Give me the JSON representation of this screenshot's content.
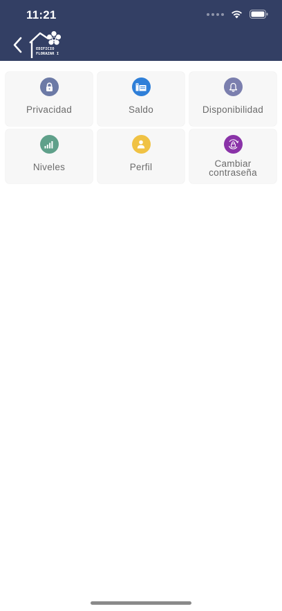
{
  "status_bar": {
    "time": "11:21"
  },
  "header": {
    "logo_line1": "EDIFICIO",
    "logo_line2": "FLORAZAR I"
  },
  "tiles": [
    {
      "label": "Privacidad",
      "icon": "lock-icon",
      "color": "#6c7aa6"
    },
    {
      "label": "Saldo",
      "icon": "money-icon",
      "color": "#2f7fd8"
    },
    {
      "label": "Disponibilidad",
      "icon": "bell-icon",
      "color": "#7b7fae"
    },
    {
      "label": "Niveles",
      "icon": "signal-bars-icon",
      "color": "#5fa08a"
    },
    {
      "label": "Perfil",
      "icon": "user-icon",
      "color": "#f0c244"
    },
    {
      "label_line1": "Cambiar",
      "label_line2": "contraseña",
      "icon": "lock-refresh-icon",
      "color": "#8a33a8"
    }
  ]
}
